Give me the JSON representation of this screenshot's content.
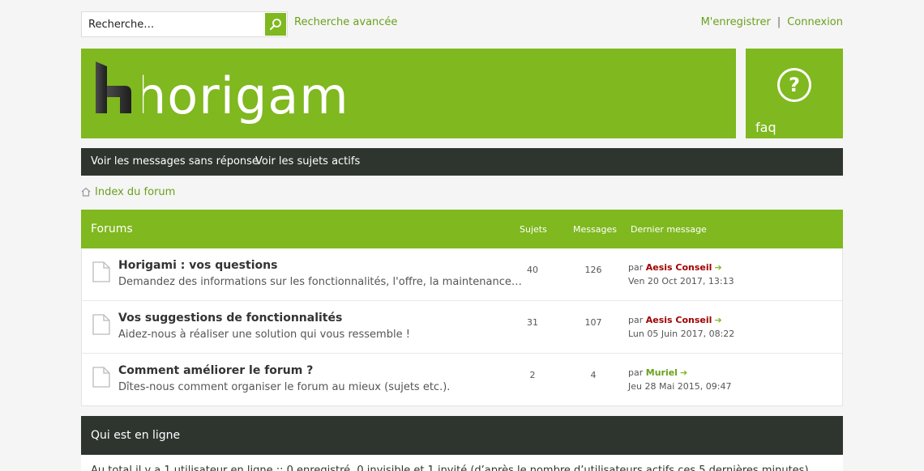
{
  "search": {
    "placeholder": "Recherche…",
    "advanced_label": "Recherche avancée"
  },
  "auth": {
    "register": "M'enregistrer",
    "separator": "|",
    "login": "Connexion"
  },
  "logo": {
    "text": "horigami"
  },
  "faq": {
    "label": "faq",
    "icon": "question-circle-icon"
  },
  "navbar": {
    "unanswered": "Voir les messages sans réponse",
    "active": "Voir les sujets actifs"
  },
  "breadcrumb": {
    "label": "Index du forum",
    "icon": "home-icon"
  },
  "forums": {
    "header": {
      "title": "Forums",
      "topics": "Sujets",
      "posts": "Messages",
      "last_post": "Dernier message"
    },
    "rows": [
      {
        "title": "Horigami : vos questions",
        "description": "Demandez des informations sur les fonctionnalités, l'offre, la maintenance…",
        "topics": "40",
        "posts": "126",
        "by_prefix": "par",
        "user": "Aesis Conseil",
        "date": "Ven 20 Oct 2017, 13:13"
      },
      {
        "title": "Vos suggestions de fonctionnalités",
        "description": "Aidez-nous à réaliser une solution qui vous ressemble !",
        "topics": "31",
        "posts": "107",
        "by_prefix": "par",
        "user": "Aesis Conseil",
        "date": "Lun 05 Juin 2017, 08:22"
      },
      {
        "title": "Comment améliorer le forum ?",
        "description": "Dîtes-nous comment organiser le forum au mieux (sujets etc.).",
        "topics": "2",
        "posts": "4",
        "by_prefix": "par",
        "user": "Muriel",
        "date": "Jeu 28 Mai 2015, 09:47"
      }
    ]
  },
  "online": {
    "title": "Qui est en ligne",
    "text": "Au total il y a 1 utilisateur en ligne :: 0 enregistré, 0 invisible et 1 invité (d’après le nombre d’utilisateurs actifs ces 5 dernières minutes)"
  },
  "colors": {
    "brand_green": "#7fb81f",
    "dark_bar": "#2e352f",
    "link_green": "#6aa11b",
    "user_red": "#a00000",
    "background": "#f5f5f5"
  }
}
